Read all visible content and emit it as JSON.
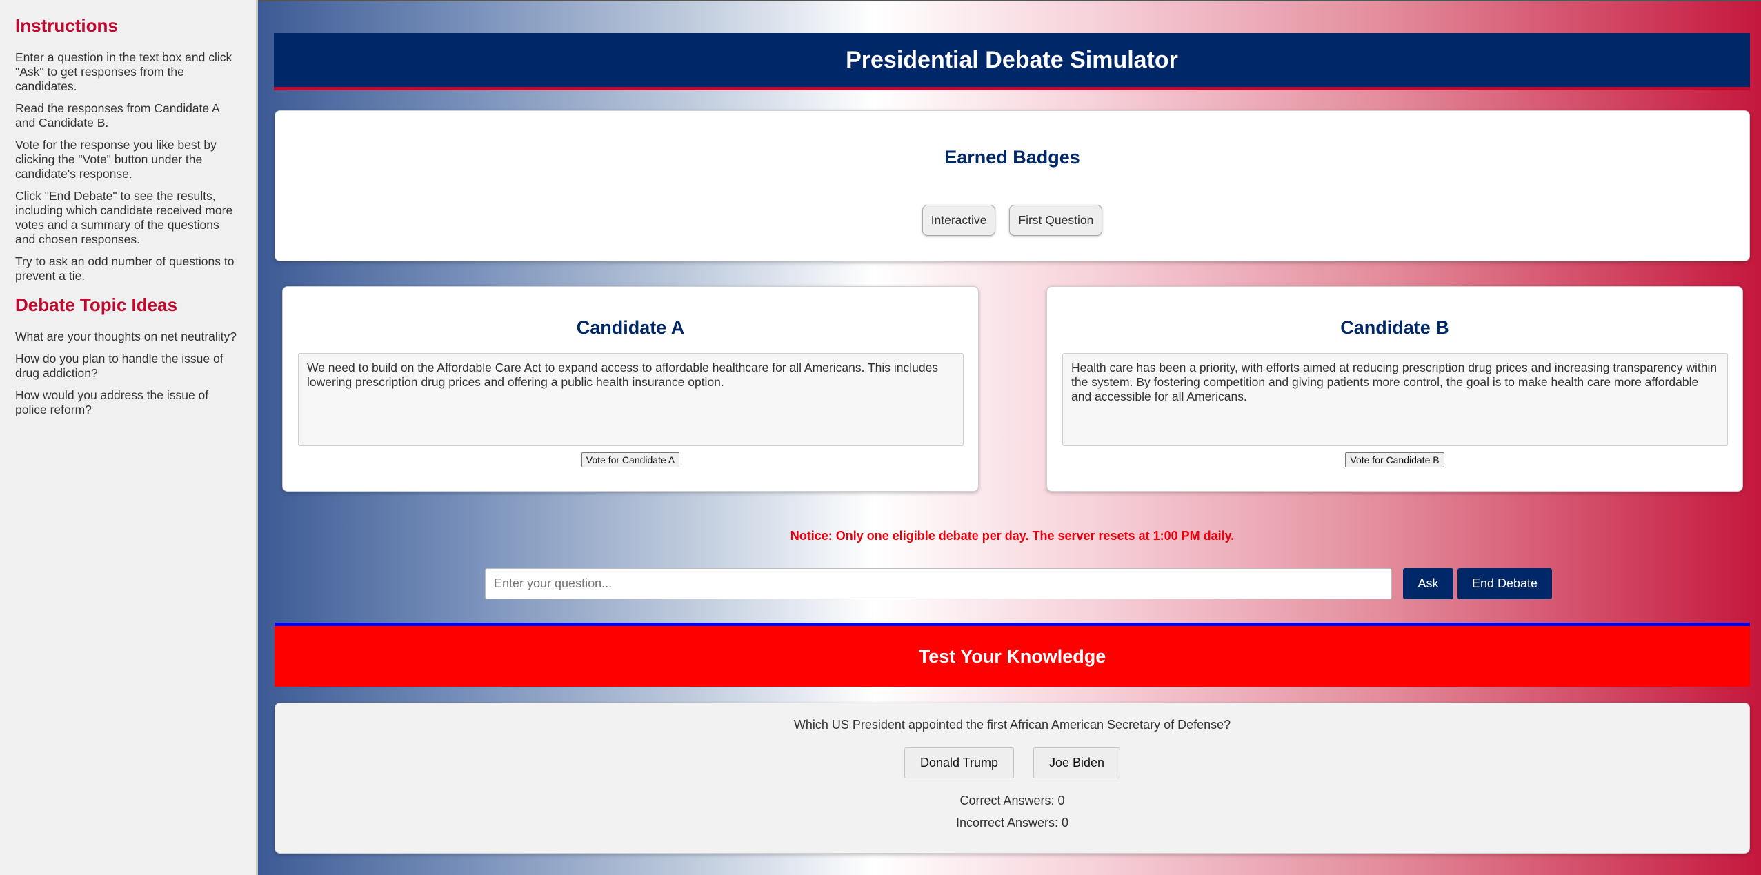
{
  "sidebar": {
    "instructions_title": "Instructions",
    "instructions": [
      "Enter a question in the text box and click \"Ask\" to get responses from the candidates.",
      "Read the responses from Candidate A and Candidate B.",
      "Vote for the response you like best by clicking the \"Vote\" button under the candidate's response.",
      "Click \"End Debate\" to see the results, including which candidate received more votes and a summary of the questions and chosen responses.",
      "Try to ask an odd number of questions to prevent a tie."
    ],
    "topics_title": "Debate Topic Ideas",
    "topics": [
      "What are your thoughts on net neutrality?",
      "How do you plan to handle the issue of drug addiction?",
      "How would you address the issue of police reform?"
    ]
  },
  "header": {
    "title": "Presidential Debate Simulator"
  },
  "badges": {
    "title": "Earned Badges",
    "items": [
      "Interactive",
      "First Question"
    ]
  },
  "candidates": {
    "a": {
      "name": "Candidate A",
      "response": "We need to build on the Affordable Care Act to expand access to affordable healthcare for all Americans. This includes lowering prescription drug prices and offering a public health insurance option.",
      "vote_label": "Vote for Candidate A"
    },
    "b": {
      "name": "Candidate B",
      "response": "Health care has been a priority, with efforts aimed at reducing prescription drug prices and increasing transparency within the system. By fostering competition and giving patients more control, the goal is to make health care more affordable and accessible for all Americans.",
      "vote_label": "Vote for Candidate B"
    }
  },
  "notice": "Notice: Only one eligible debate per day. The server resets at 1:00 PM daily.",
  "ask": {
    "placeholder": "Enter your question...",
    "value": "",
    "ask_label": "Ask",
    "end_label": "End Debate"
  },
  "quiz": {
    "title": "Test Your Knowledge",
    "question": "Which US President appointed the first African American Secretary of Defense?",
    "options": [
      "Donald Trump",
      "Joe Biden"
    ],
    "correct_text": "Correct Answers: 0",
    "incorrect_text": "Incorrect Answers: 0"
  },
  "colors": {
    "navy": "#002868",
    "red": "#bf0a30",
    "notice_red": "#e8000d",
    "quiz_bar": "#ff0000"
  }
}
